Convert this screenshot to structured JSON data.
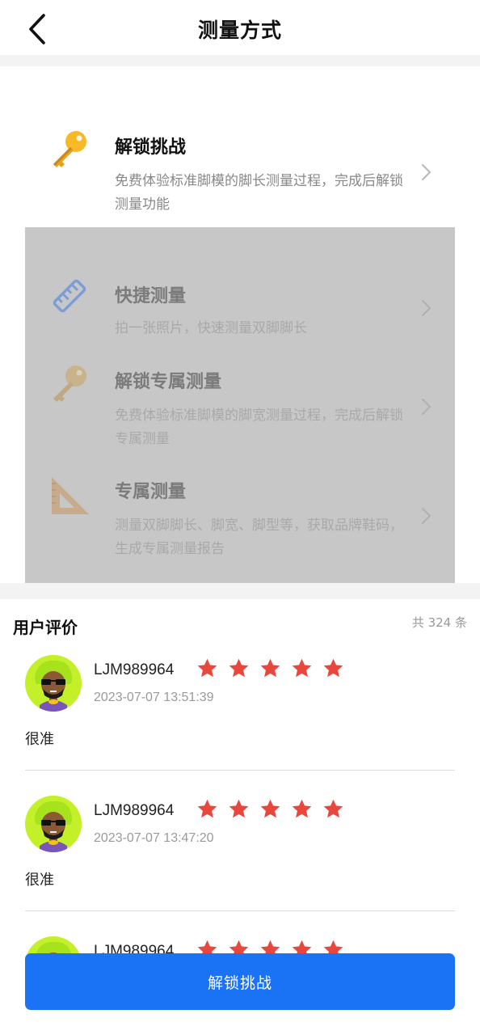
{
  "header": {
    "title": "测量方式",
    "back_icon": "chevron-left-icon"
  },
  "options": [
    {
      "icon": "key-icon",
      "title": "解锁挑战",
      "desc": "免费体验标准脚模的脚长测量过程，完成后解锁测量功能",
      "locked": false
    },
    {
      "icon": "ruler-icon",
      "title": "快捷测量",
      "desc": "拍一张照片，快速测量双脚脚长",
      "locked": true
    },
    {
      "icon": "key-icon",
      "title": "解锁专属测量",
      "desc": "免费体验标准脚模的脚宽测量过程，完成后解锁专属测量",
      "locked": true
    },
    {
      "icon": "set-square-icon",
      "title": "专属测量",
      "desc": "测量双脚脚长、脚宽、脚型等，获取品牌鞋码，生成专属测量报告",
      "locked": true
    }
  ],
  "reviews": {
    "title": "用户评价",
    "count_label": "共 324 条",
    "items": [
      {
        "name": "LJM989964",
        "rating": 5,
        "time": "2023-07-07 13:51:39",
        "content": "很准"
      },
      {
        "name": "LJM989964",
        "rating": 5,
        "time": "2023-07-07 13:47:20",
        "content": "很准"
      },
      {
        "name": "LJM989964",
        "rating": 5,
        "time": "",
        "content": ""
      }
    ]
  },
  "bottom_button": {
    "label": "解锁挑战"
  },
  "colors": {
    "accent": "#1a73f5",
    "star": "#e8473e",
    "locked_overlay": "#c7c7c7"
  }
}
